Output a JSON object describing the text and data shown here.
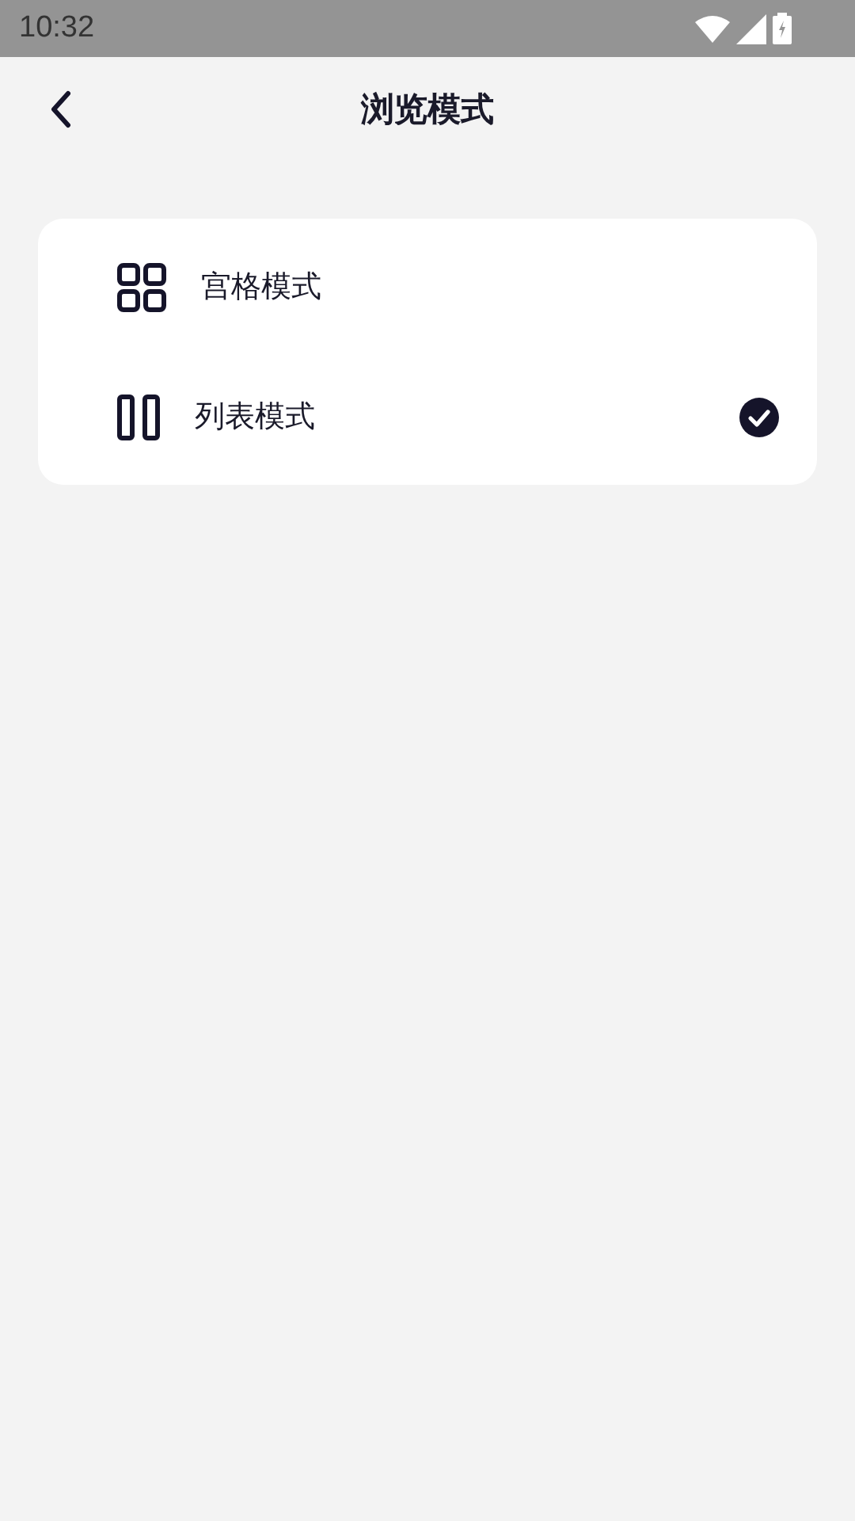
{
  "status_bar": {
    "time": "10:32"
  },
  "header": {
    "title": "浏览模式"
  },
  "options": [
    {
      "kind": "grid",
      "label": "宫格模式",
      "selected": false
    },
    {
      "kind": "list",
      "label": "列表模式",
      "selected": true
    }
  ]
}
